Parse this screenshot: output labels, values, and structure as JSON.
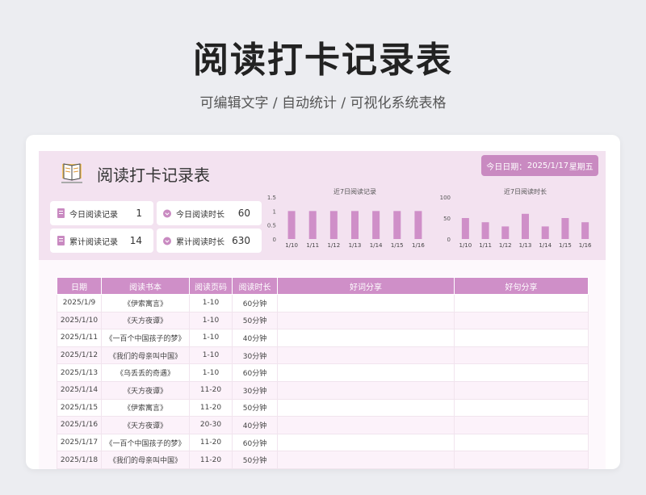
{
  "hero": {
    "title": "阅读打卡记录表",
    "subtitle": "可编辑文字 / 自动统计 / 可视化系统表格"
  },
  "dashboard": {
    "title": "阅读打卡记录表",
    "date_label": "今日日期：",
    "date_value": "2025/1/17",
    "weekday": "星期五",
    "stats": [
      {
        "label": "今日阅读记录",
        "value": "1",
        "icon": "book-icon"
      },
      {
        "label": "今日阅读时长",
        "value": "60",
        "icon": "clock-icon"
      },
      {
        "label": "累计阅读记录",
        "value": "14",
        "icon": "book-icon"
      },
      {
        "label": "累计阅读时长",
        "value": "630",
        "icon": "clock-icon"
      }
    ]
  },
  "chart_data": [
    {
      "type": "bar",
      "title": "近7日阅读记录",
      "categories": [
        "1/10",
        "1/11",
        "1/12",
        "1/13",
        "1/14",
        "1/15",
        "1/16"
      ],
      "values": [
        1,
        1,
        1,
        1,
        1,
        1,
        1
      ],
      "ylim": [
        0,
        1.5
      ],
      "yticks": [
        "1.5",
        "1",
        "0.5",
        "0"
      ],
      "color": "#cf8fc8"
    },
    {
      "type": "bar",
      "title": "近7日阅读时长",
      "categories": [
        "1/10",
        "1/11",
        "1/12",
        "1/13",
        "1/14",
        "1/15",
        "1/16"
      ],
      "values": [
        50,
        40,
        30,
        60,
        30,
        50,
        40
      ],
      "ylim": [
        0,
        100
      ],
      "yticks": [
        "100",
        "50",
        "0"
      ],
      "color": "#cf8fc8"
    }
  ],
  "table": {
    "headers": [
      "日期",
      "阅读书本",
      "阅读页码",
      "阅读时长",
      "好词分享",
      "好句分享"
    ],
    "rows": [
      [
        "2025/1/9",
        "《伊索寓言》",
        "1-10",
        "60分钟"
      ],
      [
        "2025/1/10",
        "《天方夜谭》",
        "1-10",
        "50分钟"
      ],
      [
        "2025/1/11",
        "《一百个中国孩子的梦》",
        "1-10",
        "40分钟"
      ],
      [
        "2025/1/12",
        "《我们的母亲叫中国》",
        "1-10",
        "30分钟"
      ],
      [
        "2025/1/13",
        "《乌丢丢的奇遇》",
        "1-10",
        "60分钟"
      ],
      [
        "2025/1/14",
        "《天方夜谭》",
        "11-20",
        "30分钟"
      ],
      [
        "2025/1/15",
        "《伊索寓言》",
        "11-20",
        "50分钟"
      ],
      [
        "2025/1/16",
        "《天方夜谭》",
        "20-30",
        "40分钟"
      ],
      [
        "2025/1/17",
        "《一百个中国孩子的梦》",
        "11-20",
        "60分钟"
      ],
      [
        "2025/1/18",
        "《我们的母亲叫中国》",
        "11-20",
        "50分钟"
      ]
    ]
  }
}
